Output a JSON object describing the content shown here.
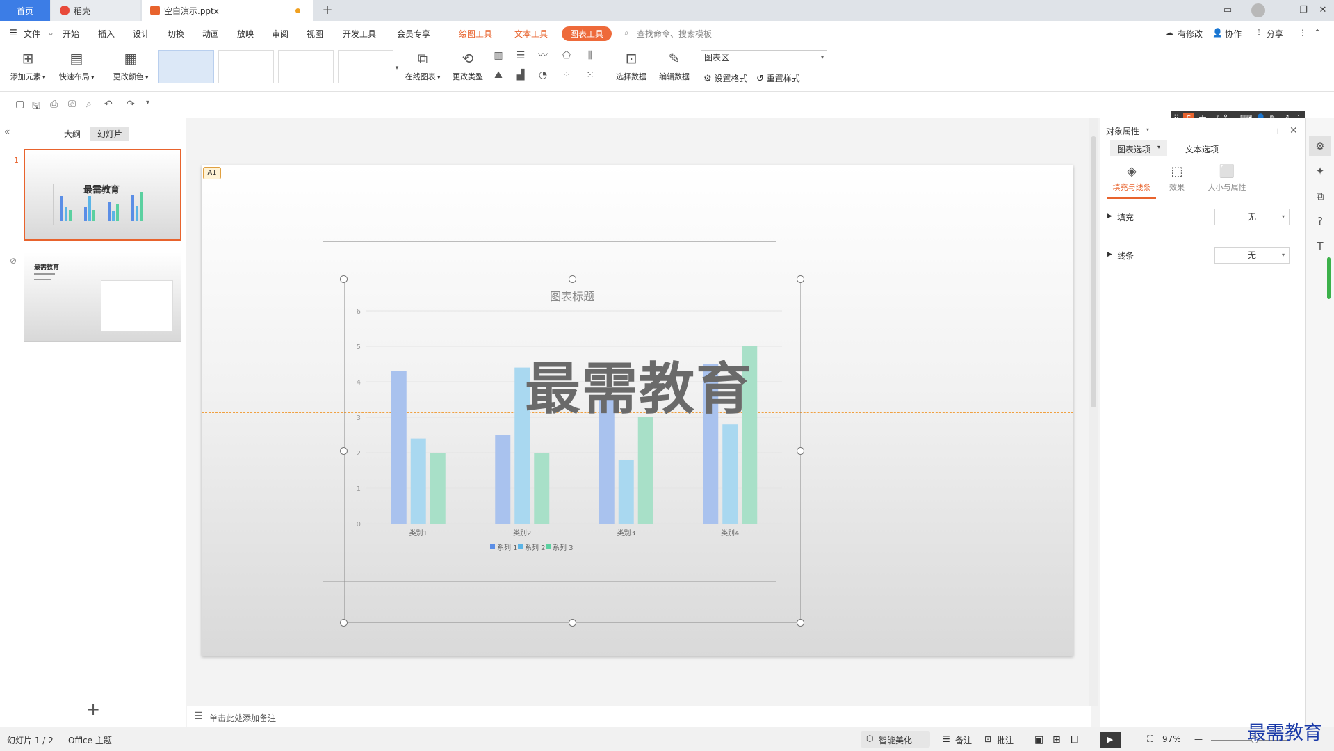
{
  "titlebar": {
    "tab_home": "首页",
    "tab_doc": "稻壳",
    "tab_file": "空白演示.pptx",
    "new_tab": "+"
  },
  "menubar": {
    "file": "文件",
    "items": [
      "开始",
      "插入",
      "设计",
      "切换",
      "动画",
      "放映",
      "审阅",
      "视图",
      "开发工具",
      "会员专享"
    ],
    "tool_tabs": [
      "绘图工具",
      "文本工具"
    ],
    "active_tool_tab": "图表工具",
    "search_placeholder": "查找命令、搜索模板",
    "right": [
      "有修改",
      "协作",
      "分享"
    ]
  },
  "ribbon": {
    "add_element": "添加元素",
    "quick_layout": "快速布局",
    "change_color": "更改颜色",
    "online_chart": "在线图表",
    "change_type": "更改类型",
    "select_data": "选择数据",
    "edit_data": "编辑数据",
    "chart_area_select": "图表区",
    "set_format": "设置格式",
    "reset_style": "重置样式"
  },
  "left_panel": {
    "tab_outline": "大纲",
    "tab_slides": "幻灯片",
    "slide1_num": "1",
    "slide1_title": "最需教育",
    "slide2_title": "最需教育",
    "add_slide": "+"
  },
  "slide": {
    "badge": "A1",
    "overlay_title": "最需教育"
  },
  "chart_data": {
    "type": "bar",
    "title": "图表标题",
    "categories": [
      "类别1",
      "类别2",
      "类别3",
      "类别4"
    ],
    "series": [
      {
        "name": "系列 1",
        "values": [
          4.3,
          2.5,
          3.5,
          4.5
        ],
        "color": "#a9c2ee"
      },
      {
        "name": "系列 2",
        "values": [
          2.4,
          4.4,
          1.8,
          2.8
        ],
        "color": "#a9d8f0"
      },
      {
        "name": "系列 3",
        "values": [
          2.0,
          2.0,
          3.0,
          5.0
        ],
        "color": "#a8e0c8"
      }
    ],
    "legend_swatches": [
      "#5b8ee6",
      "#5bb4e6",
      "#5bd0a0"
    ],
    "y_ticks": [
      "0",
      "1",
      "2",
      "3",
      "4",
      "5",
      "6"
    ],
    "ylim": [
      0,
      6
    ],
    "grid": true,
    "legend": "bottom"
  },
  "notes": {
    "placeholder": "单击此处添加备注"
  },
  "right_panel": {
    "title": "对象属性",
    "tab_chart_options": "图表选项",
    "tab_text_options": "文本选项",
    "sub_fill_line": "填充与线条",
    "sub_effect": "效果",
    "sub_size": "大小与属性",
    "fill_label": "填充",
    "fill_value": "无",
    "line_label": "线条",
    "line_value": "无"
  },
  "ime": {
    "lang": "中"
  },
  "statusbar": {
    "slide_count": "幻灯片 1 / 2",
    "theme": "Office 主题",
    "smart_beautify": "智能美化",
    "notes": "备注",
    "comments": "批注",
    "zoom": "97%"
  },
  "watermark": "最需教育",
  "colors": {
    "accent": "#e8632d",
    "home_tab": "#3c7de6"
  }
}
